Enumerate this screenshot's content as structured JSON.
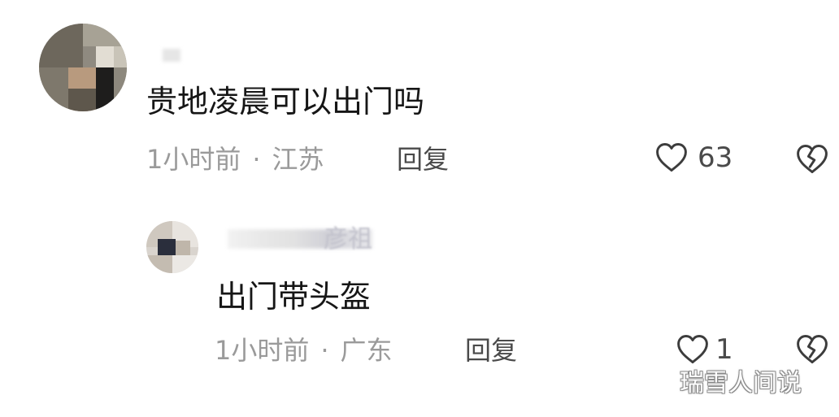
{
  "comments": [
    {
      "text": "贵地凌晨可以出门吗",
      "time": "1小时前",
      "separator": "·",
      "location": "江苏",
      "reply_label": "回复",
      "likes": "63",
      "like_icon": "heart-outline-icon",
      "dislike_icon": "broken-heart-icon"
    }
  ],
  "reply": {
    "username_suffix": "彦祖",
    "text": "出门带头盔",
    "time": "1小时前",
    "separator": "·",
    "location": "广东",
    "reply_label": "回复",
    "likes": "1",
    "like_icon": "heart-outline-icon",
    "dislike_icon": "broken-heart-icon"
  },
  "watermark": "瑞雪人间说",
  "colors": {
    "text_primary": "#161616",
    "text_secondary": "#9a9a9a",
    "action_text": "#4a4a4a",
    "background": "#ffffff"
  }
}
